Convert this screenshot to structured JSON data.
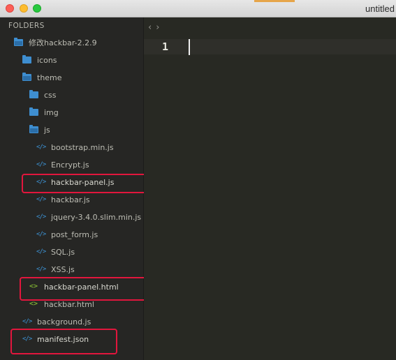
{
  "window": {
    "title": "untitled"
  },
  "sidebar": {
    "header": "FOLDERS",
    "items": [
      {
        "label": "修改hackbar-2.2.9",
        "type": "folder-open",
        "icon": "folder-open-icon"
      },
      {
        "label": "icons",
        "type": "folder",
        "icon": "folder-icon"
      },
      {
        "label": "theme",
        "type": "folder-open",
        "icon": "folder-open-icon"
      },
      {
        "label": "css",
        "type": "folder",
        "icon": "folder-icon"
      },
      {
        "label": "img",
        "type": "folder",
        "icon": "folder-icon"
      },
      {
        "label": "js",
        "type": "folder-open",
        "icon": "folder-open-icon"
      },
      {
        "label": "bootstrap.min.js",
        "type": "js",
        "icon": "code-file-icon"
      },
      {
        "label": "Encrypt.js",
        "type": "js",
        "icon": "code-file-icon"
      },
      {
        "label": "hackbar-panel.js",
        "type": "js",
        "icon": "code-file-icon"
      },
      {
        "label": "hackbar.js",
        "type": "js",
        "icon": "code-file-icon"
      },
      {
        "label": "jquery-3.4.0.slim.min.js",
        "type": "js",
        "icon": "code-file-icon"
      },
      {
        "label": "post_form.js",
        "type": "js",
        "icon": "code-file-icon"
      },
      {
        "label": "SQL.js",
        "type": "js",
        "icon": "code-file-icon"
      },
      {
        "label": "XSS.js",
        "type": "js",
        "icon": "code-file-icon"
      },
      {
        "label": "hackbar-panel.html",
        "type": "html",
        "icon": "html-file-icon"
      },
      {
        "label": "hackbar.html",
        "type": "html",
        "icon": "html-file-icon"
      },
      {
        "label": "background.js",
        "type": "js",
        "icon": "code-file-icon"
      },
      {
        "label": "manifest.json",
        "type": "json",
        "icon": "code-file-icon"
      }
    ]
  },
  "editor": {
    "nav_back": "‹",
    "nav_forward": "›",
    "line_number": "1"
  },
  "colors": {
    "folder": "#3e8ed0",
    "js_icon": "#3d95d8",
    "html_icon": "#7aa832",
    "highlight": "#e2163d",
    "editor_bg": "#282923",
    "sidebar_bg": "#262624"
  }
}
